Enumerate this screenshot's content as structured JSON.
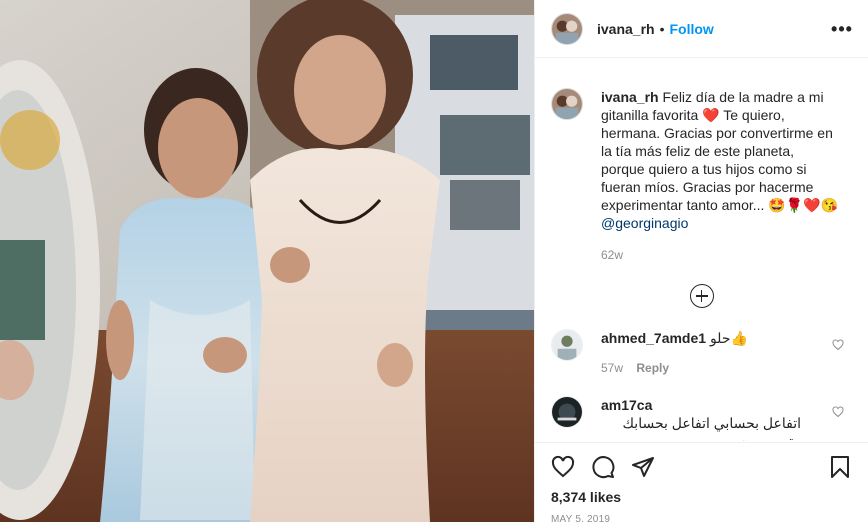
{
  "post": {
    "username": "ivana_rh",
    "dot": "•",
    "follow_label": "Follow",
    "more_label": "•••",
    "caption_text": "Feliz día de la madre a mi gitanilla favorita ❤️ Te quiero, hermana. Gracias por convertirme en la tía más feliz de este planeta, porque quiero a tus hijos como si fueran míos. Gracias por hacerme experimentar tanto amor... 🤩🌹❤️😘",
    "mention": "@georginagio",
    "caption_time": "62w"
  },
  "comments": [
    {
      "username": "ahmed_7amde1",
      "text": "حلو👍",
      "time": "57w",
      "reply_label": "Reply"
    },
    {
      "username": "am17ca",
      "text": "اتفاعل بحسابي اتفاعل بحسابك متوصى بيه"
    }
  ],
  "footer": {
    "likes": "8,374 likes",
    "date": "MAY 5, 2019"
  },
  "icons": {
    "like": "heart-icon",
    "comment": "comment-icon",
    "share": "share-icon",
    "save": "bookmark-icon",
    "load_more": "plus-circle-icon"
  }
}
